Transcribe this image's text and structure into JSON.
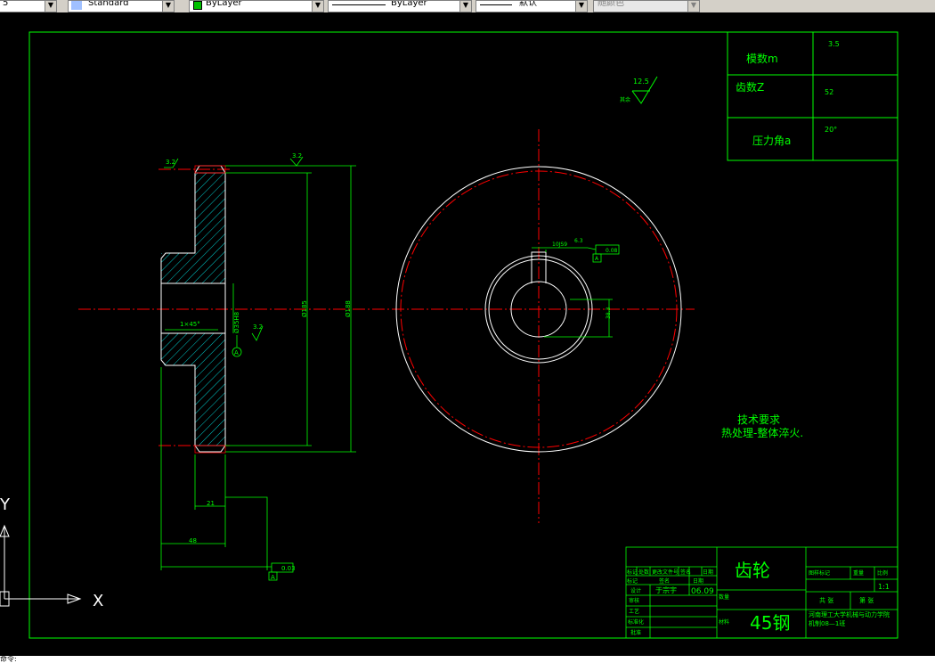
{
  "toolbar": {
    "seg1": "5",
    "textstyle": "Standard",
    "layer": "ByLayer",
    "linetype": "ByLayer",
    "lineweight": "默认",
    "plotstyle": "随颜色"
  },
  "colors": {
    "green": "#00ff00",
    "white": "#ffffff",
    "red": "#ff0000",
    "bg": "#000000"
  },
  "params_table": {
    "rows": [
      {
        "label": "模数m",
        "value": "3.5"
      },
      {
        "label": "齿数Z",
        "value": "52"
      },
      {
        "label": "压力角a",
        "value": "20°"
      }
    ]
  },
  "roughness_top": {
    "value": "12.5",
    "note": "其余"
  },
  "tech_req": {
    "title": "技术要求",
    "line1": "热处理-整体淬火."
  },
  "dims": {
    "rough_left": "3.2",
    "rough_mid": "3.2",
    "rough_bore": "3.2",
    "chamfer": "1×45°",
    "bore_dia": "Ø35H8",
    "dia1": "Ø185",
    "dia2": "Ø188",
    "width1": "21",
    "width2": "48",
    "datum": "A",
    "tol_runout": "0.03",
    "key_dim1": "10JS9",
    "key_dim2": "6.3",
    "key_tol": "0.08",
    "key_depth": "38.3"
  },
  "title_block": {
    "part_name": "齿轮",
    "material": "45钢",
    "school": "河南理工大学机械与动力学院",
    "class": "机制08—1班",
    "scale": "1:1",
    "rev_headers": [
      "标记",
      "处数",
      "更改文件号",
      "签名",
      "日期"
    ],
    "left_labels": [
      "设计",
      "审核",
      "工艺",
      "标准化",
      "批准"
    ],
    "left_sub": [
      "标记",
      "签名",
      "日期"
    ],
    "designer": "于宗宇",
    "date": "06.09",
    "stage_label": "图样标记",
    "weight_label": "重量",
    "scale_label": "比例",
    "qty_label": "数量",
    "material_label": "材料",
    "sheet_total": "共 张",
    "sheet_no": "第 张"
  },
  "ucs": {
    "x": "X",
    "y": "Y"
  },
  "cmdline": "命令:"
}
